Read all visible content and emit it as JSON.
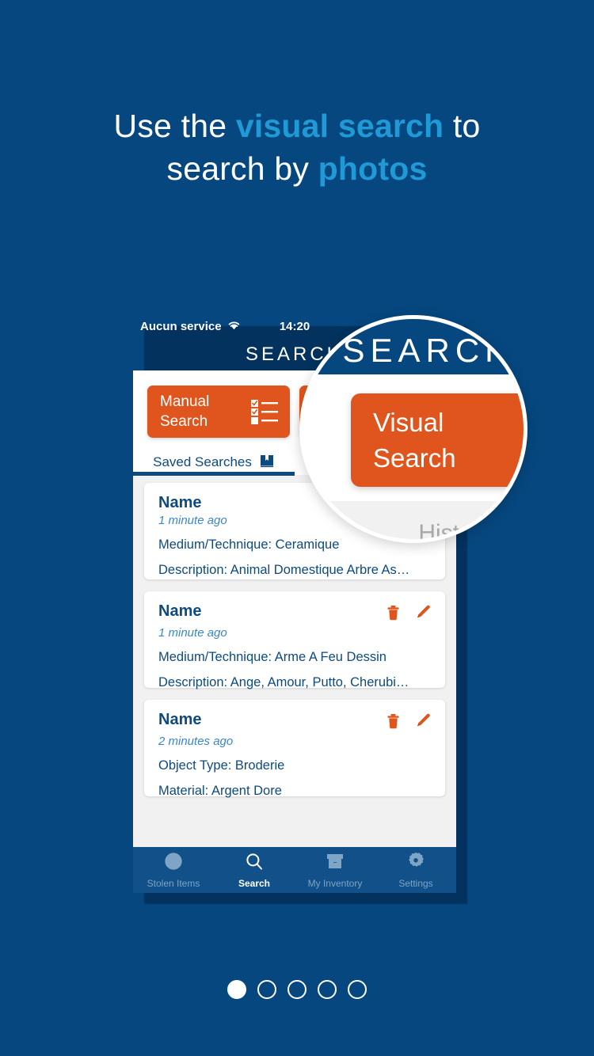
{
  "headline": {
    "line1_pre": "Use the ",
    "line1_accent": "visual search",
    "line1_post": " to",
    "line2_pre": "search by ",
    "line2_accent": "photos"
  },
  "colors": {
    "background": "#06477f",
    "accent_blue": "#1f9ad6",
    "orange": "#e0551d",
    "dark_blue": "#0d4a80",
    "screen_bg": "#f1f1f1",
    "tabbar_bg": "#115089",
    "muted_gray": "#a8a8a8",
    "time_blue": "#3a86c8"
  },
  "phone": {
    "status_bar": {
      "carrier": "Aucun service",
      "wifi_icon": "wifi-icon",
      "time": "14:20"
    },
    "header": {
      "title": "SEARCH"
    },
    "buttons": {
      "manual": {
        "label": "Manual\nSearch",
        "label_line1": "Manual",
        "label_line2": "Search",
        "icon": "checklist-icon"
      },
      "visual": {
        "label_line1": "Visual",
        "label_line2": "Search",
        "icon": "camera-icon"
      }
    },
    "tabs": [
      {
        "label": "Saved Searches",
        "icon": "bookmark-book-icon",
        "active": true
      },
      {
        "label": "History",
        "icon": "history-clock-icon",
        "active": false
      }
    ],
    "cards": [
      {
        "name": "Name",
        "time": "1 minute ago",
        "line1": "Medium/Technique: Ceramique",
        "line2": "Description: Animal Domestique Arbre As…",
        "has_actions": false
      },
      {
        "name": "Name",
        "time": "1 minute ago",
        "line1": "Medium/Technique: Arme A Feu Dessin",
        "line2": "Description: Ange, Amour, Putto, Cherubi…",
        "has_actions": true
      },
      {
        "name": "Name",
        "time": "2 minutes ago",
        "line1": "Object Type: Broderie",
        "line2": "Material: Argent Dore",
        "has_actions": true
      }
    ],
    "card_actions": {
      "delete_icon": "trash-icon",
      "edit_icon": "pencil-icon"
    },
    "tab_bar": [
      {
        "label": "Stolen Items",
        "icon": "globe-icon",
        "active": false
      },
      {
        "label": "Search",
        "icon": "magnifier-icon",
        "active": true
      },
      {
        "label": "My Inventory",
        "icon": "box-icon",
        "active": false
      },
      {
        "label": "Settings",
        "icon": "gear-icon",
        "active": false
      }
    ]
  },
  "magnifier": {
    "title": "SEARCH",
    "visual_button": {
      "line1": "Visual",
      "line2": "Search",
      "icon": "camera-icon"
    },
    "history": {
      "label": "History",
      "icon": "history-clock-icon"
    }
  },
  "pagination": {
    "total": 5,
    "active_index": 0
  }
}
